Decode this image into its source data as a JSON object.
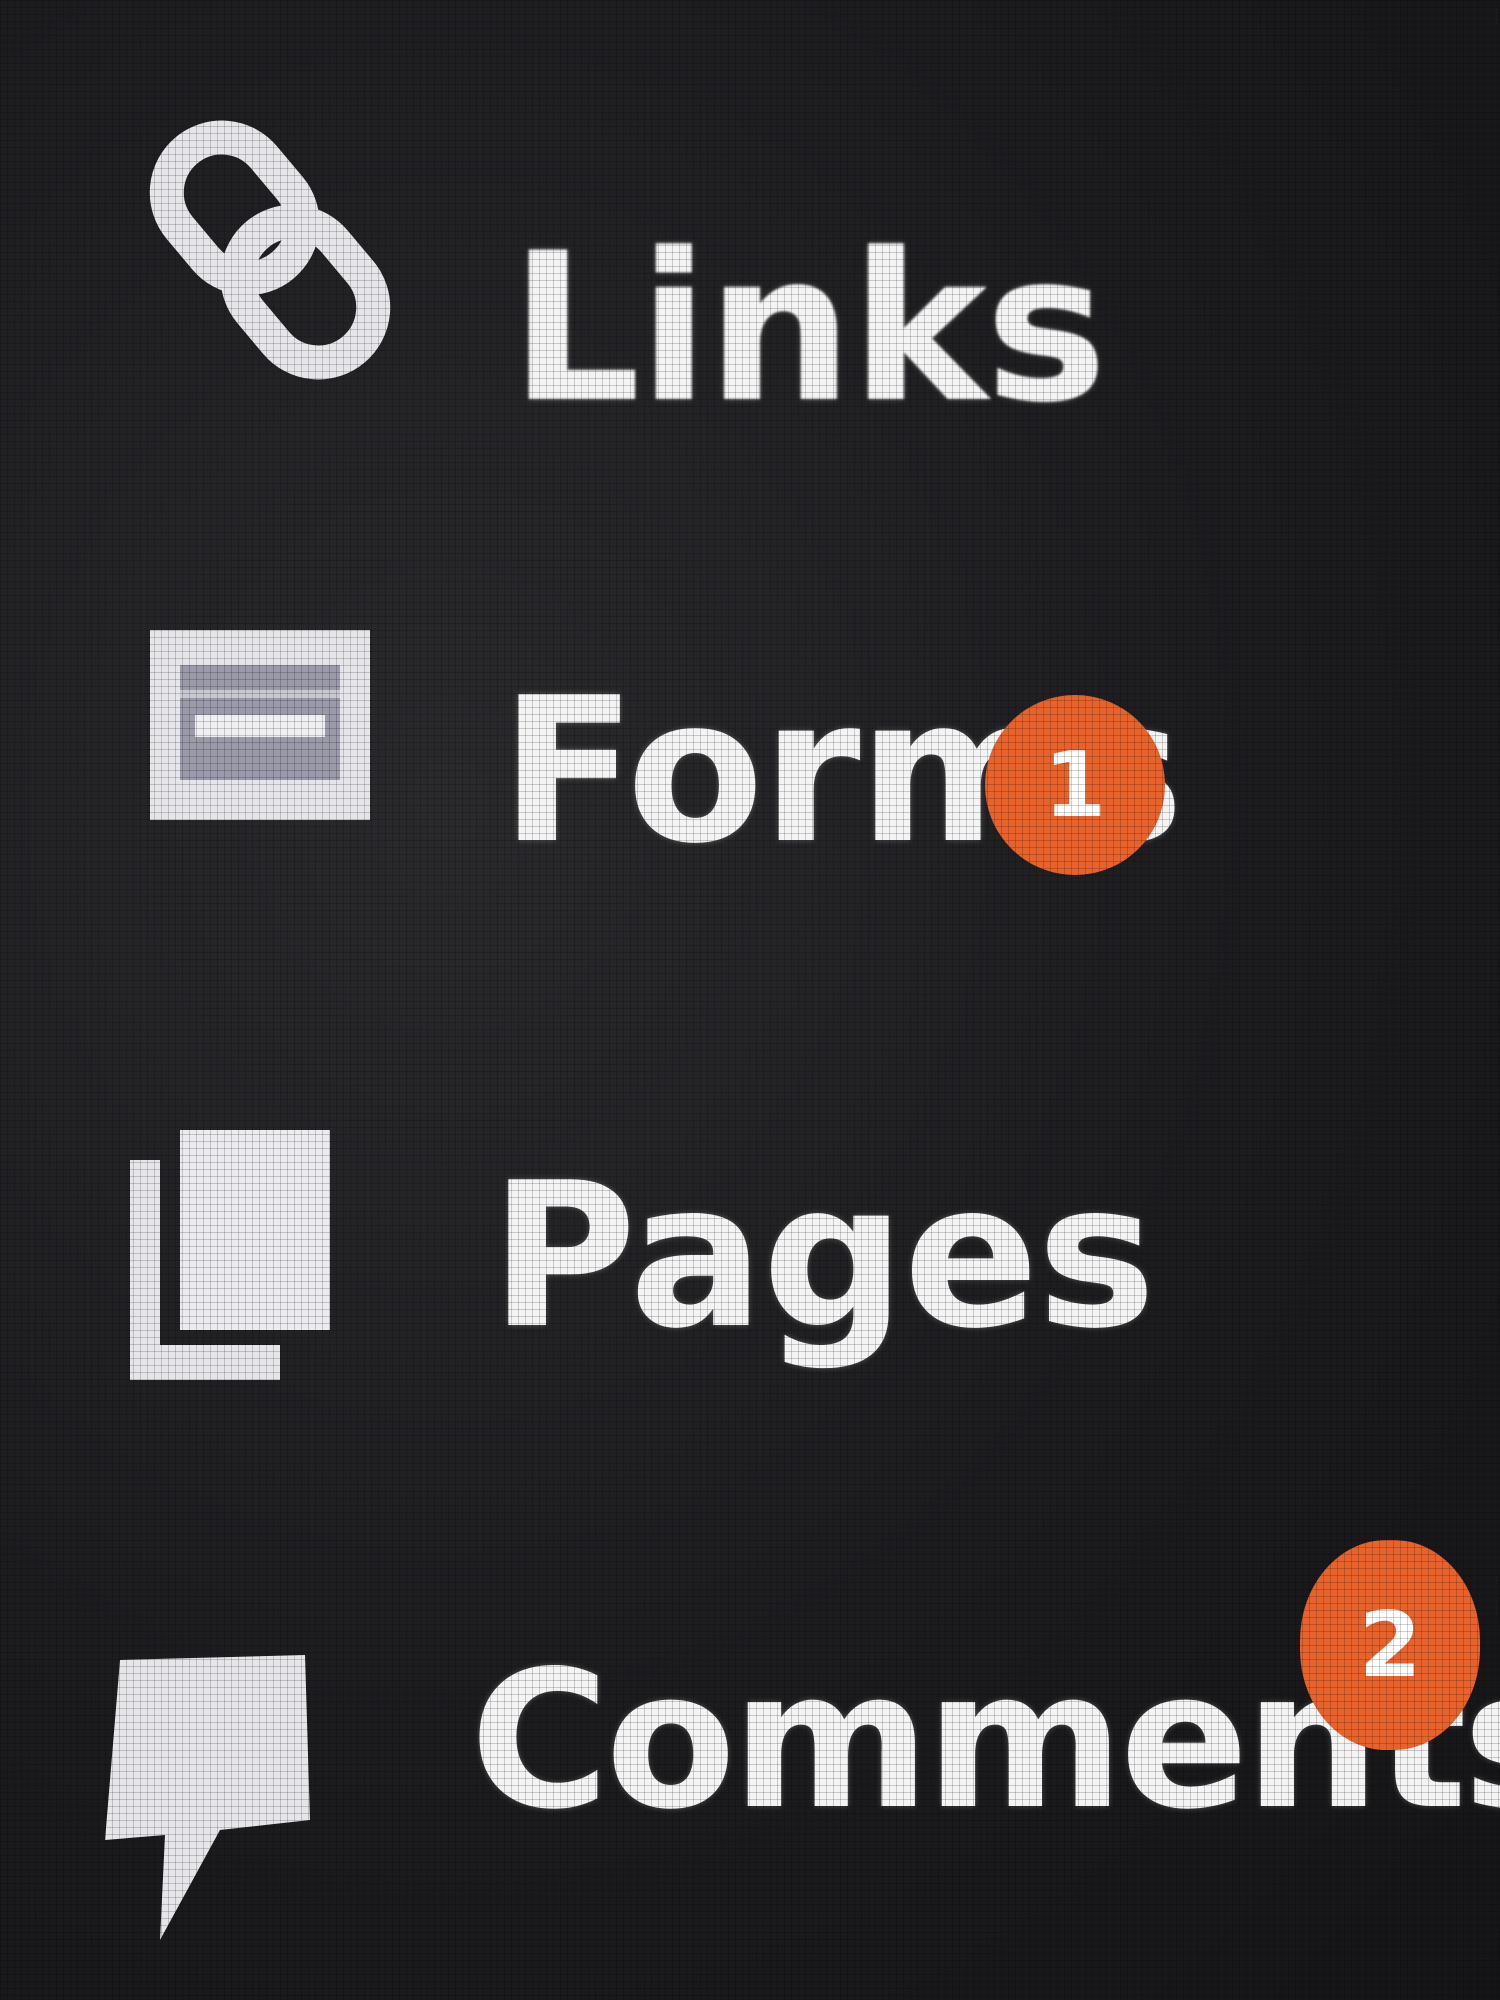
{
  "sidebar": {
    "items": [
      {
        "label": "Links",
        "icon": "link-icon"
      },
      {
        "label": "Forms",
        "icon": "form-icon",
        "badge": "1"
      },
      {
        "label": "Pages",
        "icon": "pages-icon"
      },
      {
        "label": "Comments",
        "icon": "comment-icon",
        "badge": "2"
      }
    ]
  },
  "colors": {
    "background": "#1f1f22",
    "text": "#f4f4f4",
    "badge": "#e8622c"
  }
}
